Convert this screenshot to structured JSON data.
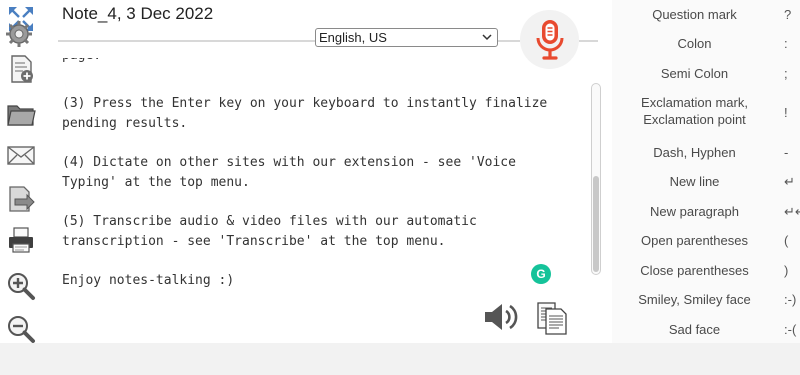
{
  "note": {
    "title": "Note_4, 3 Dec 2022"
  },
  "language": {
    "selected": "English, US"
  },
  "toolbar": {
    "icons": [
      "fullscreen-icon",
      "settings-icon",
      "new-note-icon",
      "open-folder-icon",
      "email-icon",
      "export-icon",
      "print-icon",
      "zoom-in-icon",
      "zoom-out-icon"
    ]
  },
  "editor": {
    "cut_line": "page.",
    "lines": [
      "(3) Press the Enter key on your keyboard to instantly finalize",
      "pending results.",
      "",
      "(4) Dictate on other sites with our extension - see 'Voice",
      "Typing' at the top menu.",
      "",
      "(5) Transcribe audio & video files with our automatic",
      "transcription - see 'Transcribe' at the top menu.",
      "",
      "Enjoy notes-talking :)"
    ]
  },
  "grammarly": {
    "letter": "G"
  },
  "punctuation": [
    {
      "name": "Question mark",
      "symbol": "?"
    },
    {
      "name": "Colon",
      "symbol": ":"
    },
    {
      "name": "Semi Colon",
      "symbol": ";"
    },
    {
      "name": "Exclamation mark,\nExclamation point",
      "symbol": "!"
    },
    {
      "name": "Dash, Hyphen",
      "symbol": "-"
    },
    {
      "name": "New line",
      "symbol": "↵"
    },
    {
      "name": "New paragraph",
      "symbol": "↵↵"
    },
    {
      "name": "Open parentheses",
      "symbol": "("
    },
    {
      "name": "Close parentheses",
      "symbol": ")"
    },
    {
      "name": "Smiley, Smiley face",
      "symbol": ":-)"
    },
    {
      "name": "Sad face",
      "symbol": ":-("
    }
  ],
  "colors": {
    "mic_red": "#e84a2f",
    "grammarly_green": "#15c39a",
    "divider": "#d8d8d8",
    "panel_bg": "#fafafa"
  }
}
